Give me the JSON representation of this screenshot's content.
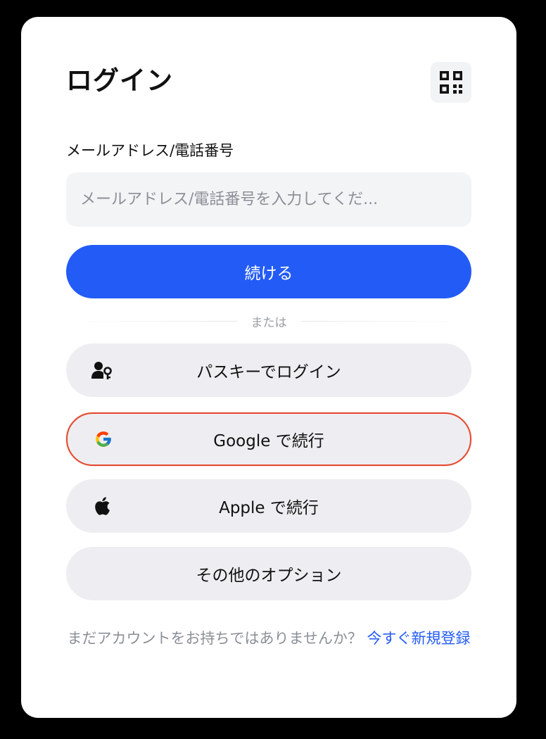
{
  "login": {
    "title": "ログイン",
    "qr_icon": "qr-code-icon",
    "field_label": "メールアドレス/電話番号",
    "input_value": "",
    "input_placeholder": "メールアドレス/電話番号を入力してくだ...",
    "continue_label": "続ける",
    "divider_text": "または",
    "options": {
      "passkey": {
        "label": "パスキーでログイン",
        "icon": "passkey-user-key-icon"
      },
      "google": {
        "label": "Google で続行",
        "icon": "google-logo-icon"
      },
      "apple": {
        "label": "Apple で続行",
        "icon": "apple-logo-icon"
      },
      "other": {
        "label": "その他のオプション"
      }
    },
    "footer": {
      "prompt": "まだアカウントをお持ちではありませんか？",
      "signup_link": "今すぐ新規登録"
    }
  },
  "colors": {
    "backdrop": "#000000",
    "card": "#ffffff",
    "accent": "#235bf6",
    "secondary_button": "#eeeef2",
    "input_background": "#f3f4f6",
    "highlight_border": "#e5492f",
    "muted_text": "#8b8f97"
  }
}
